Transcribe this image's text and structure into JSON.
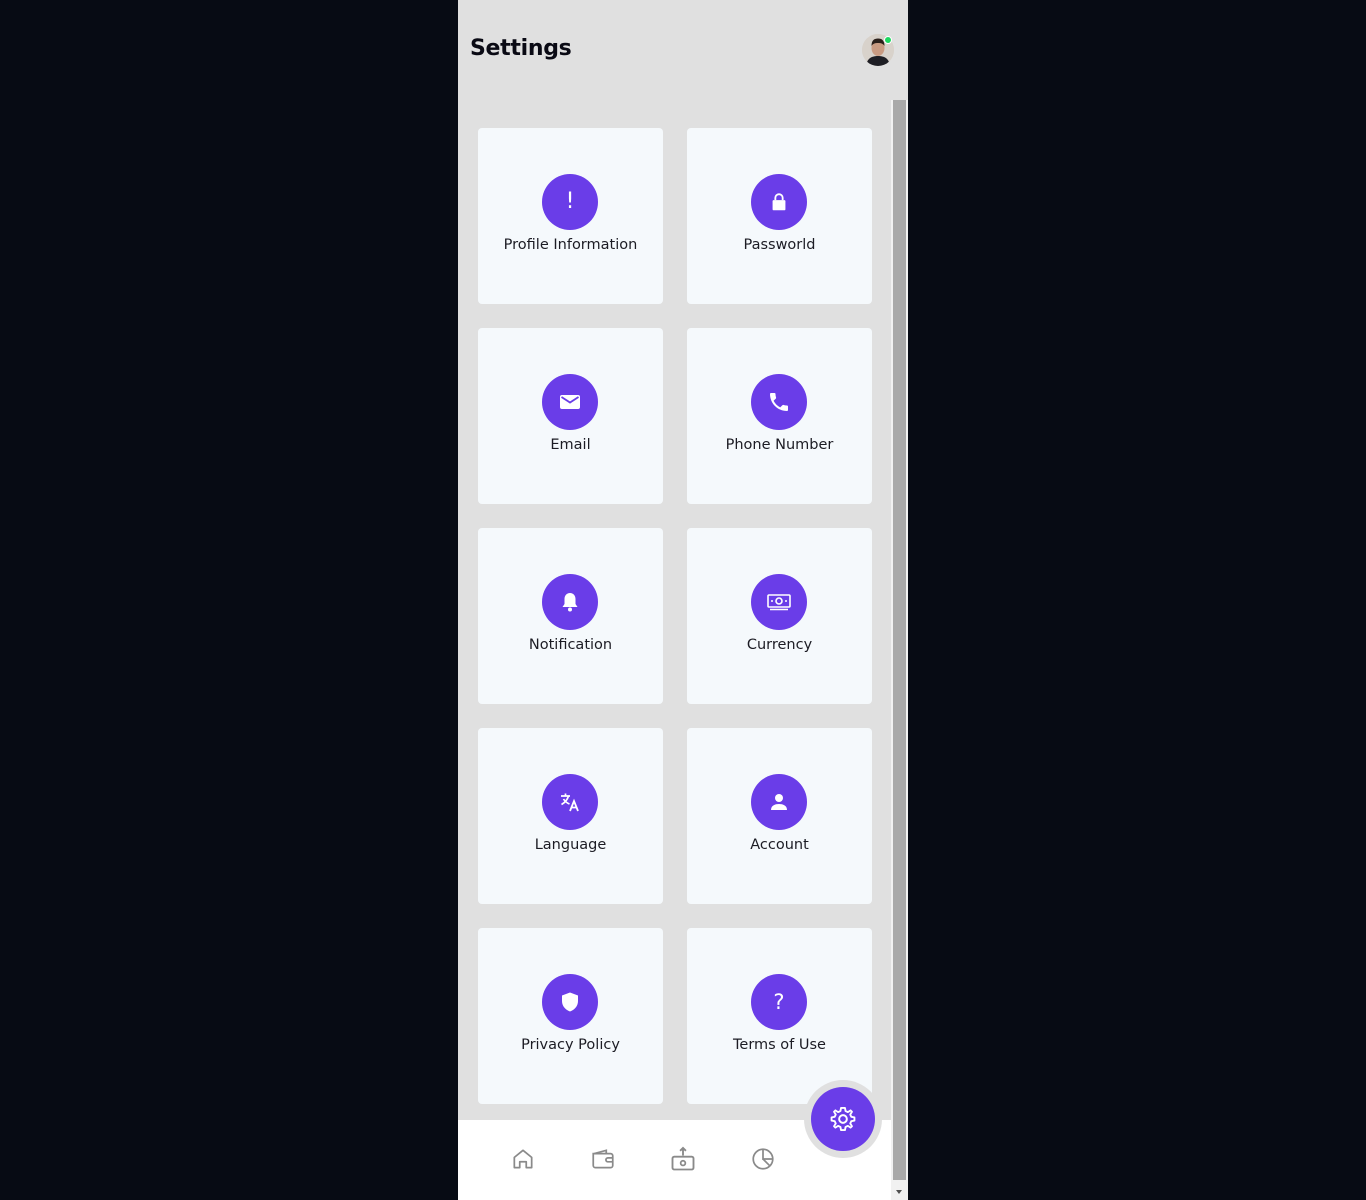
{
  "header": {
    "title": "Settings"
  },
  "settings": [
    {
      "label": "Profile Information",
      "icon": "exclamation-icon",
      "glyph": "!"
    },
    {
      "label": "Passworld",
      "icon": "lock-icon"
    },
    {
      "label": "Email",
      "icon": "envelope-icon"
    },
    {
      "label": "Phone Number",
      "icon": "phone-icon"
    },
    {
      "label": "Notification",
      "icon": "bell-icon"
    },
    {
      "label": "Currency",
      "icon": "money-icon"
    },
    {
      "label": "Language",
      "icon": "translate-icon"
    },
    {
      "label": "Account",
      "icon": "user-icon"
    },
    {
      "label": "Privacy Policy",
      "icon": "shield-icon"
    },
    {
      "label": "Terms of Use",
      "icon": "question-icon",
      "glyph": "?"
    }
  ],
  "bottom_nav": [
    "home-icon",
    "wallet-icon",
    "transfer-icon",
    "pie-chart-icon"
  ],
  "colors": {
    "accent": "#6a3de8",
    "card": "#f5f9fc",
    "panel": "#e0e0e0",
    "online": "#1ed760"
  }
}
